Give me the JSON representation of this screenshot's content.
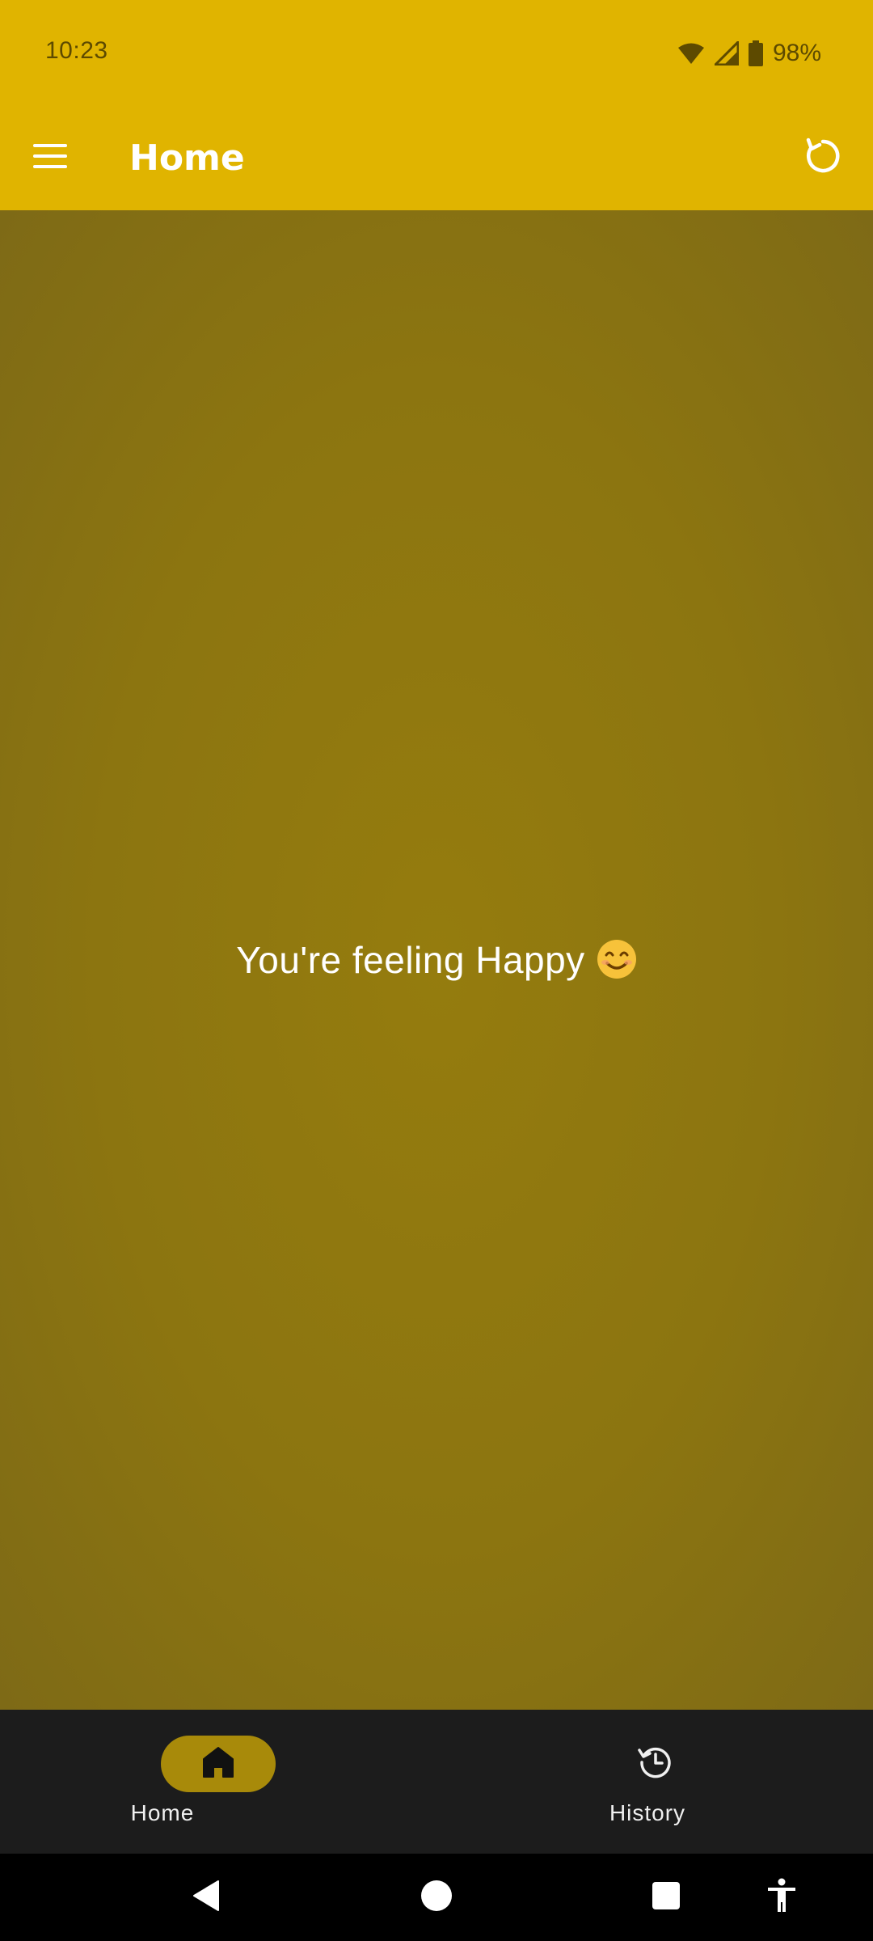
{
  "status_bar": {
    "time": "10:23",
    "battery": "98%",
    "icons": [
      "wifi-icon",
      "cell-signal-icon",
      "battery-icon"
    ]
  },
  "app_bar": {
    "title": "Home",
    "menu_icon": "menu-icon",
    "refresh_icon": "refresh-icon",
    "background": "#e0b400"
  },
  "main": {
    "mood_text": "You're feeling Happy",
    "mood_emoji": "smiling-face-emoji",
    "background": "#8c7510"
  },
  "bottom_nav": {
    "items": [
      {
        "label": "Home",
        "icon": "home-icon",
        "selected": true
      },
      {
        "label": "History",
        "icon": "history-icon",
        "selected": false
      }
    ],
    "indicator_color": "#a88a0a"
  },
  "system_nav": {
    "buttons": [
      "back-icon",
      "home-circle-icon",
      "recents-icon",
      "accessibility-icon"
    ]
  }
}
